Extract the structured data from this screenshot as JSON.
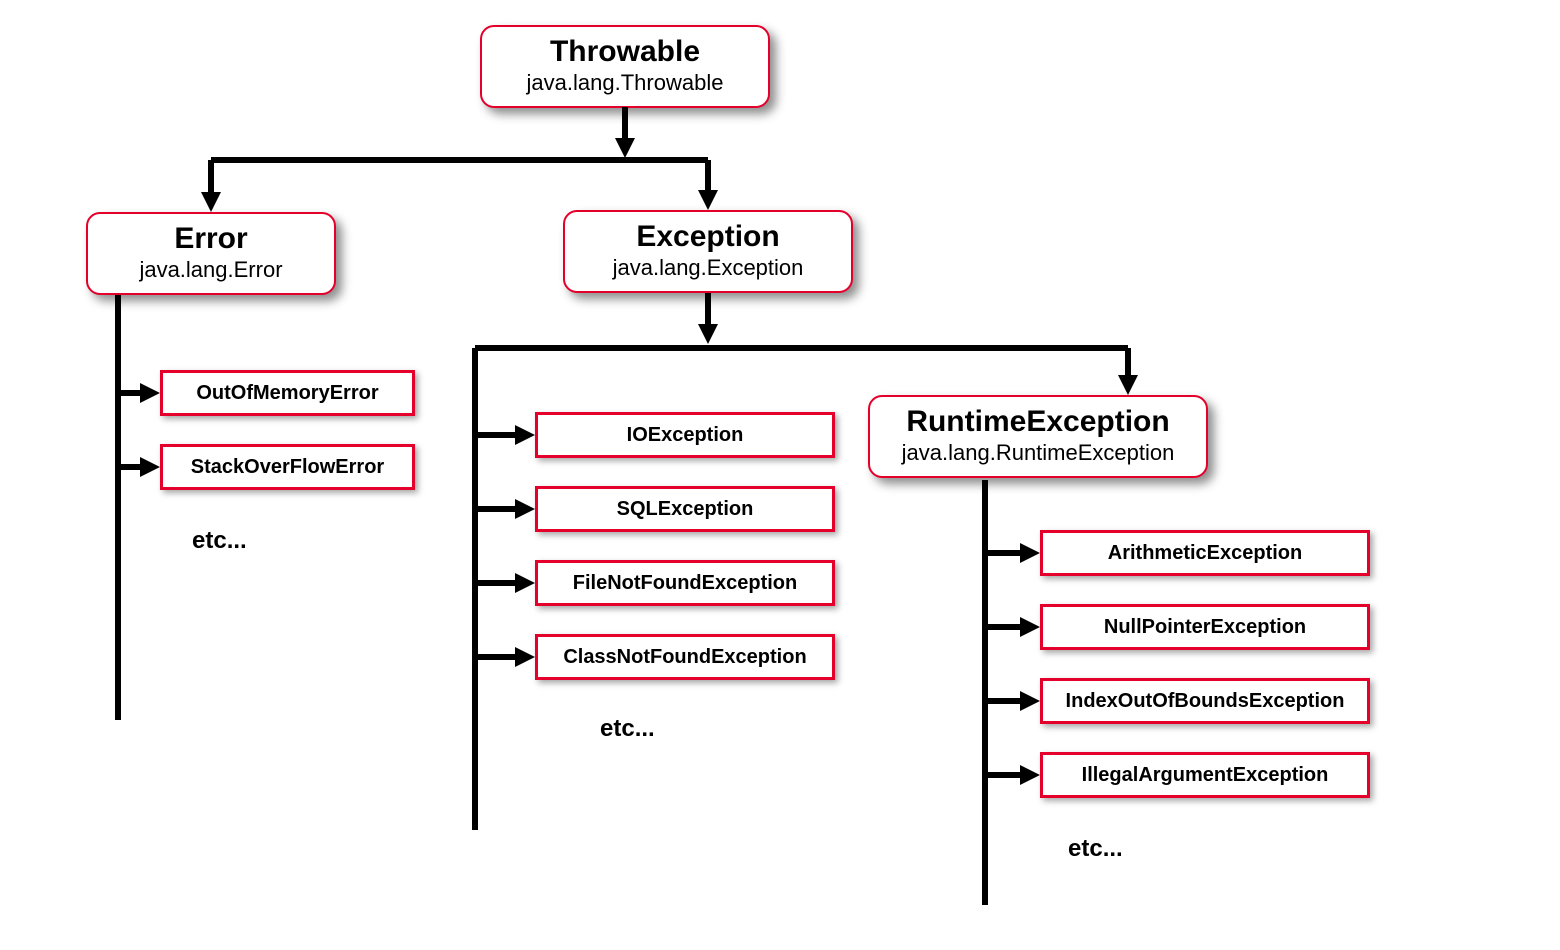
{
  "throwable": {
    "title": "Throwable",
    "pkg": "java.lang.Throwable"
  },
  "error": {
    "title": "Error",
    "pkg": "java.lang.Error"
  },
  "exception": {
    "title": "Exception",
    "pkg": "java.lang.Exception"
  },
  "runtime": {
    "title": "RuntimeException",
    "pkg": "java.lang.RuntimeException"
  },
  "error_children": [
    "OutOfMemoryError",
    "StackOverFlowError"
  ],
  "exception_children": [
    "IOException",
    "SQLException",
    "FileNotFoundException",
    "ClassNotFoundException"
  ],
  "runtime_children": [
    "ArithmeticException",
    "NullPointerException",
    "IndexOutOfBoundsException",
    "IllegalArgumentException"
  ],
  "etc": "etc...",
  "colors": {
    "accent": "#e4002b"
  }
}
